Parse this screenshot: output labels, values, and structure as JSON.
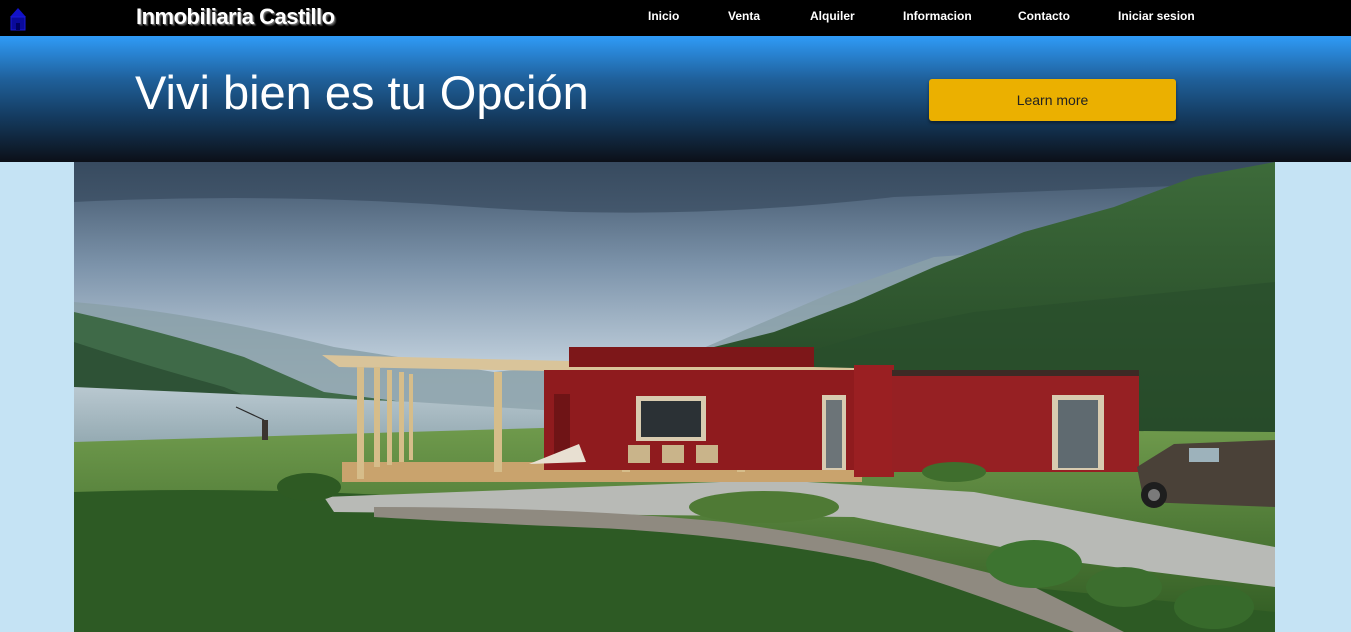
{
  "navbar": {
    "brand": "Inmobiliaria Castillo",
    "links": [
      "Inicio",
      "Venta",
      "Alquiler",
      "Informacion",
      "Contacto",
      "Iniciar sesion"
    ],
    "home_icon": "home-icon"
  },
  "hero": {
    "title": "Vivi bien es tu Opción",
    "button_label": "Learn more"
  },
  "colors": {
    "navbar_bg": "#000000",
    "hero_gradient_top": "#2f9bf7",
    "hero_gradient_bottom": "#0c1018",
    "button_bg": "#ebb000",
    "page_bg": "#c5e3f4"
  }
}
